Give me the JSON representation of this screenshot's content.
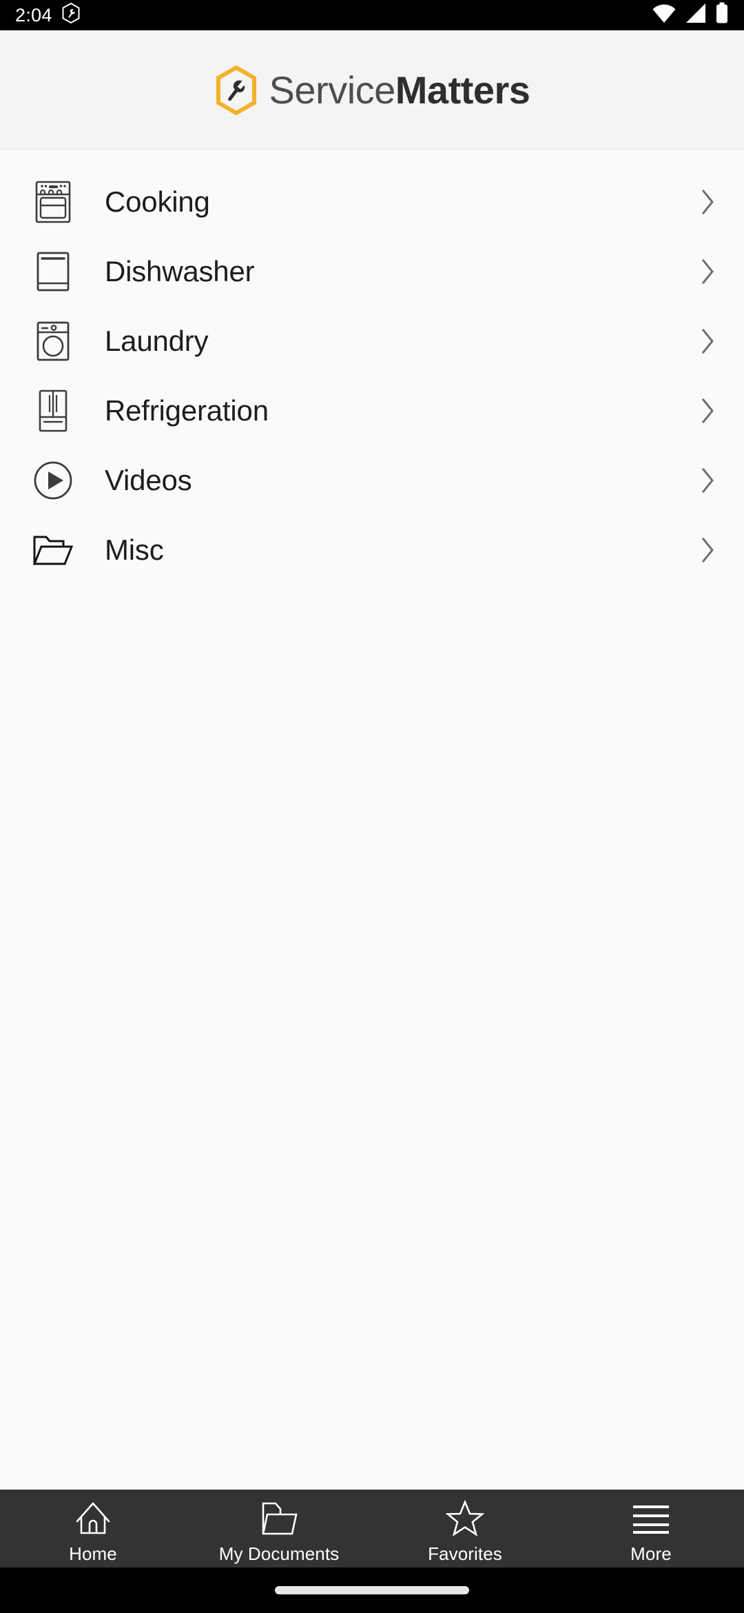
{
  "status_bar": {
    "time": "2:04",
    "left_icons": [
      {
        "name": "app-notification-icon",
        "glyph": "hexagon-wrench"
      }
    ],
    "right_icons": [
      {
        "name": "wifi-icon",
        "glyph": "wifi"
      },
      {
        "name": "cellular-signal-icon",
        "glyph": "signal"
      },
      {
        "name": "battery-icon",
        "glyph": "battery-full"
      }
    ],
    "background": "#000000",
    "foreground": "#ffffff"
  },
  "header": {
    "logo_icon_name": "servicematters-hexagon-wrench-logo",
    "brand_first": "Service",
    "brand_second": "Matters",
    "accent_color": "#F2B32C",
    "text_color": "#3a3a3a",
    "background": "#f4f4f4"
  },
  "list": {
    "items": [
      {
        "label": "Cooking",
        "icon": "range-oven-icon",
        "chevron": "chevron-right-icon"
      },
      {
        "label": "Dishwasher",
        "icon": "dishwasher-icon",
        "chevron": "chevron-right-icon"
      },
      {
        "label": "Laundry",
        "icon": "washing-machine-icon",
        "chevron": "chevron-right-icon"
      },
      {
        "label": "Refrigeration",
        "icon": "refrigerator-icon",
        "chevron": "chevron-right-icon"
      },
      {
        "label": "Videos",
        "icon": "play-circle-icon",
        "chevron": "chevron-right-icon"
      },
      {
        "label": "Misc",
        "icon": "open-folder-icon",
        "chevron": "chevron-right-icon"
      }
    ],
    "background": "#fafafa",
    "label_color": "#1d1d1d",
    "icon_color": "#3c3c3c",
    "chevron_color": "#6e6e6e"
  },
  "bottom_nav": {
    "background": "#333333",
    "label_color": "#ffffff",
    "items": [
      {
        "label": "Home",
        "icon": "home-icon"
      },
      {
        "label": "My Documents",
        "icon": "folder-icon"
      },
      {
        "label": "Favorites",
        "icon": "star-icon"
      },
      {
        "label": "More",
        "icon": "hamburger-menu-icon"
      }
    ]
  },
  "gesture_bar": {
    "name": "android-gesture-pill",
    "color": "#e8e8e8",
    "background": "#000000"
  }
}
